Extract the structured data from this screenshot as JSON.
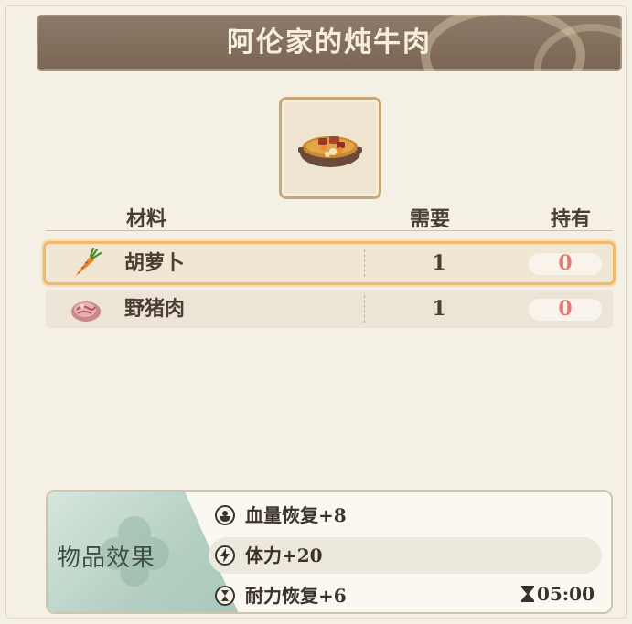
{
  "recipe": {
    "title": "阿伦家的炖牛肉"
  },
  "table": {
    "headers": {
      "material": "材料",
      "need": "需要",
      "have": "持有"
    },
    "rows": [
      {
        "icon": "carrot-icon",
        "name": "胡萝卜",
        "need": "1",
        "have": "0",
        "selected": true
      },
      {
        "icon": "boar-meat-icon",
        "name": "野猪肉",
        "need": "1",
        "have": "0",
        "selected": false
      }
    ]
  },
  "effects": {
    "label": "物品效果",
    "items": [
      {
        "icon": "health-icon",
        "text": "血量恢复+8"
      },
      {
        "icon": "lightning-icon",
        "text": "体力+20"
      },
      {
        "icon": "hourglass-icon",
        "text": "耐力恢复+6"
      }
    ],
    "timer": "05:00"
  },
  "colors": {
    "header_bg": "#7a6553",
    "title_text": "#f7efdc",
    "have_zero": "#e07a73",
    "selected_glow": "#f2b870",
    "effects_tag": "#b4cfc2"
  }
}
